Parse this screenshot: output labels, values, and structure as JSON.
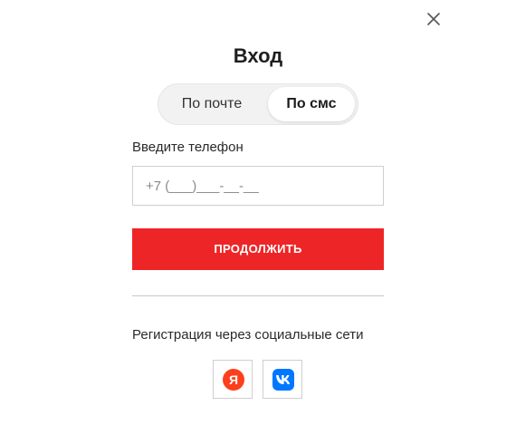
{
  "dialog": {
    "title": "Вход",
    "close_icon": "close-icon"
  },
  "tabs": [
    {
      "label": "По почте",
      "active": false
    },
    {
      "label": "По смс",
      "active": true
    }
  ],
  "phone": {
    "label": "Введите телефон",
    "placeholder": "+7 (___)___-__-__",
    "value": ""
  },
  "continue_button": {
    "label": "ПРОДОЛЖИТЬ",
    "color": "#ee2527"
  },
  "social": {
    "label": "Регистрация через социальные сети",
    "providers": [
      {
        "name": "yandex",
        "glyph": "Я",
        "icon": "yandex-icon",
        "color": "#fc3f1d"
      },
      {
        "name": "vk",
        "icon": "vk-icon",
        "color": "#0077ff"
      }
    ]
  }
}
